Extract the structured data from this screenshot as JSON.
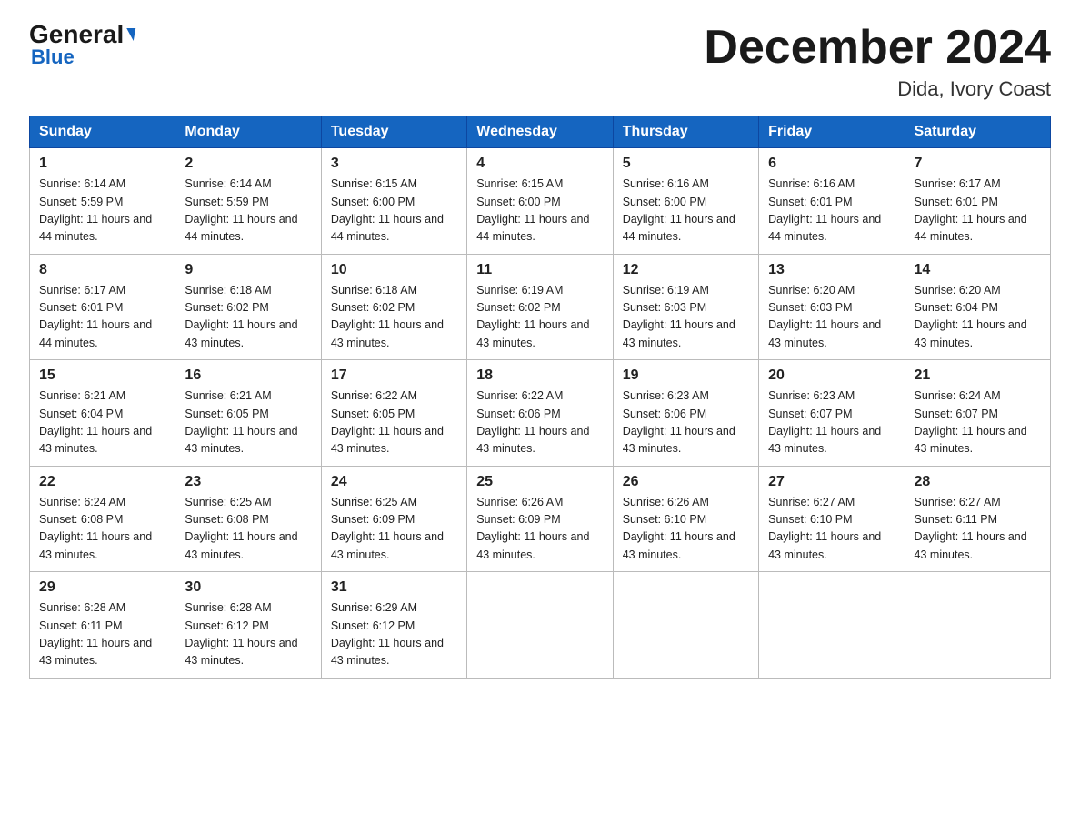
{
  "header": {
    "logo_general": "General",
    "logo_blue": "Blue",
    "month_title": "December 2024",
    "location": "Dida, Ivory Coast"
  },
  "days_of_week": [
    "Sunday",
    "Monday",
    "Tuesday",
    "Wednesday",
    "Thursday",
    "Friday",
    "Saturday"
  ],
  "weeks": [
    [
      {
        "day": "1",
        "sunrise": "6:14 AM",
        "sunset": "5:59 PM",
        "daylight": "11 hours and 44 minutes."
      },
      {
        "day": "2",
        "sunrise": "6:14 AM",
        "sunset": "5:59 PM",
        "daylight": "11 hours and 44 minutes."
      },
      {
        "day": "3",
        "sunrise": "6:15 AM",
        "sunset": "6:00 PM",
        "daylight": "11 hours and 44 minutes."
      },
      {
        "day": "4",
        "sunrise": "6:15 AM",
        "sunset": "6:00 PM",
        "daylight": "11 hours and 44 minutes."
      },
      {
        "day": "5",
        "sunrise": "6:16 AM",
        "sunset": "6:00 PM",
        "daylight": "11 hours and 44 minutes."
      },
      {
        "day": "6",
        "sunrise": "6:16 AM",
        "sunset": "6:01 PM",
        "daylight": "11 hours and 44 minutes."
      },
      {
        "day": "7",
        "sunrise": "6:17 AM",
        "sunset": "6:01 PM",
        "daylight": "11 hours and 44 minutes."
      }
    ],
    [
      {
        "day": "8",
        "sunrise": "6:17 AM",
        "sunset": "6:01 PM",
        "daylight": "11 hours and 44 minutes."
      },
      {
        "day": "9",
        "sunrise": "6:18 AM",
        "sunset": "6:02 PM",
        "daylight": "11 hours and 43 minutes."
      },
      {
        "day": "10",
        "sunrise": "6:18 AM",
        "sunset": "6:02 PM",
        "daylight": "11 hours and 43 minutes."
      },
      {
        "day": "11",
        "sunrise": "6:19 AM",
        "sunset": "6:02 PM",
        "daylight": "11 hours and 43 minutes."
      },
      {
        "day": "12",
        "sunrise": "6:19 AM",
        "sunset": "6:03 PM",
        "daylight": "11 hours and 43 minutes."
      },
      {
        "day": "13",
        "sunrise": "6:20 AM",
        "sunset": "6:03 PM",
        "daylight": "11 hours and 43 minutes."
      },
      {
        "day": "14",
        "sunrise": "6:20 AM",
        "sunset": "6:04 PM",
        "daylight": "11 hours and 43 minutes."
      }
    ],
    [
      {
        "day": "15",
        "sunrise": "6:21 AM",
        "sunset": "6:04 PM",
        "daylight": "11 hours and 43 minutes."
      },
      {
        "day": "16",
        "sunrise": "6:21 AM",
        "sunset": "6:05 PM",
        "daylight": "11 hours and 43 minutes."
      },
      {
        "day": "17",
        "sunrise": "6:22 AM",
        "sunset": "6:05 PM",
        "daylight": "11 hours and 43 minutes."
      },
      {
        "day": "18",
        "sunrise": "6:22 AM",
        "sunset": "6:06 PM",
        "daylight": "11 hours and 43 minutes."
      },
      {
        "day": "19",
        "sunrise": "6:23 AM",
        "sunset": "6:06 PM",
        "daylight": "11 hours and 43 minutes."
      },
      {
        "day": "20",
        "sunrise": "6:23 AM",
        "sunset": "6:07 PM",
        "daylight": "11 hours and 43 minutes."
      },
      {
        "day": "21",
        "sunrise": "6:24 AM",
        "sunset": "6:07 PM",
        "daylight": "11 hours and 43 minutes."
      }
    ],
    [
      {
        "day": "22",
        "sunrise": "6:24 AM",
        "sunset": "6:08 PM",
        "daylight": "11 hours and 43 minutes."
      },
      {
        "day": "23",
        "sunrise": "6:25 AM",
        "sunset": "6:08 PM",
        "daylight": "11 hours and 43 minutes."
      },
      {
        "day": "24",
        "sunrise": "6:25 AM",
        "sunset": "6:09 PM",
        "daylight": "11 hours and 43 minutes."
      },
      {
        "day": "25",
        "sunrise": "6:26 AM",
        "sunset": "6:09 PM",
        "daylight": "11 hours and 43 minutes."
      },
      {
        "day": "26",
        "sunrise": "6:26 AM",
        "sunset": "6:10 PM",
        "daylight": "11 hours and 43 minutes."
      },
      {
        "day": "27",
        "sunrise": "6:27 AM",
        "sunset": "6:10 PM",
        "daylight": "11 hours and 43 minutes."
      },
      {
        "day": "28",
        "sunrise": "6:27 AM",
        "sunset": "6:11 PM",
        "daylight": "11 hours and 43 minutes."
      }
    ],
    [
      {
        "day": "29",
        "sunrise": "6:28 AM",
        "sunset": "6:11 PM",
        "daylight": "11 hours and 43 minutes."
      },
      {
        "day": "30",
        "sunrise": "6:28 AM",
        "sunset": "6:12 PM",
        "daylight": "11 hours and 43 minutes."
      },
      {
        "day": "31",
        "sunrise": "6:29 AM",
        "sunset": "6:12 PM",
        "daylight": "11 hours and 43 minutes."
      },
      null,
      null,
      null,
      null
    ]
  ]
}
